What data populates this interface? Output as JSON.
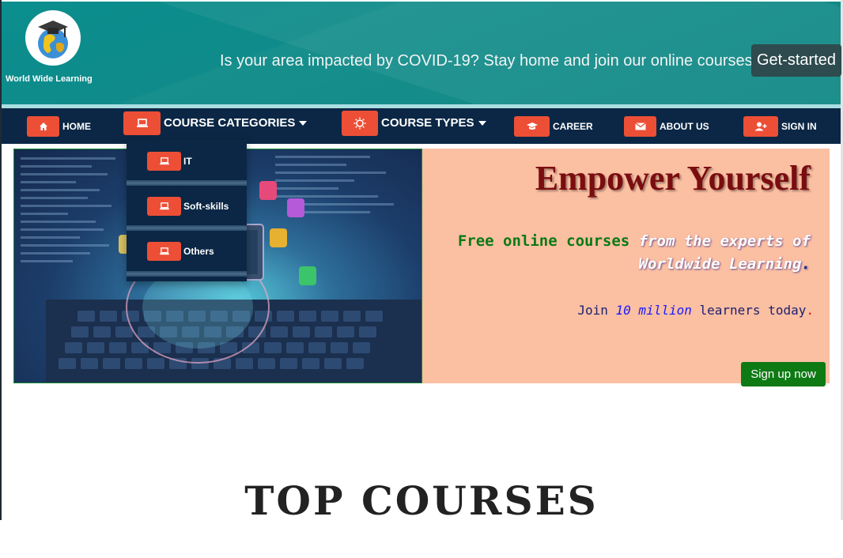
{
  "header": {
    "logo_title": "World Wide Learning",
    "covid_message": "Is your area impacted by COVID-19? Stay home and join our online courses.",
    "get_started_label": "Get-started",
    "accent_color": "#0b8e8e"
  },
  "nav": {
    "items": [
      {
        "label": "HOME",
        "icon": "home-icon"
      },
      {
        "label": "COURSE CATEGORIES",
        "icon": "laptop-icon"
      },
      {
        "label": "COURSE TYPES",
        "icon": "sun-icon"
      },
      {
        "label": "CAREER",
        "icon": "graduation-cap-icon"
      },
      {
        "label": "ABOUT US",
        "icon": "envelope-icon"
      },
      {
        "label": "SIGN IN",
        "icon": "user-plus-icon"
      }
    ],
    "background_color": "#0b2745",
    "button_color": "#ec4f36"
  },
  "dropdown": {
    "items": [
      {
        "label": "IT",
        "icon": "laptop-icon"
      },
      {
        "label": "Soft-skills",
        "icon": "laptop-icon"
      },
      {
        "label": "Others",
        "icon": "laptop-icon"
      }
    ]
  },
  "hero": {
    "title": "Empower Yourself",
    "line1_green": "Free online courses",
    "line1_white": "from the experts of",
    "line2": "Worldwide Learning",
    "line2_dot": ".",
    "line3_pre": "Join ",
    "line3_highlight": "10 million",
    "line3_post": " learners today",
    "line3_dot": ".",
    "signup_label": "Sign up now",
    "panel_color": "#fbbfa2"
  },
  "main": {
    "section_title": "TOP COURSES"
  }
}
